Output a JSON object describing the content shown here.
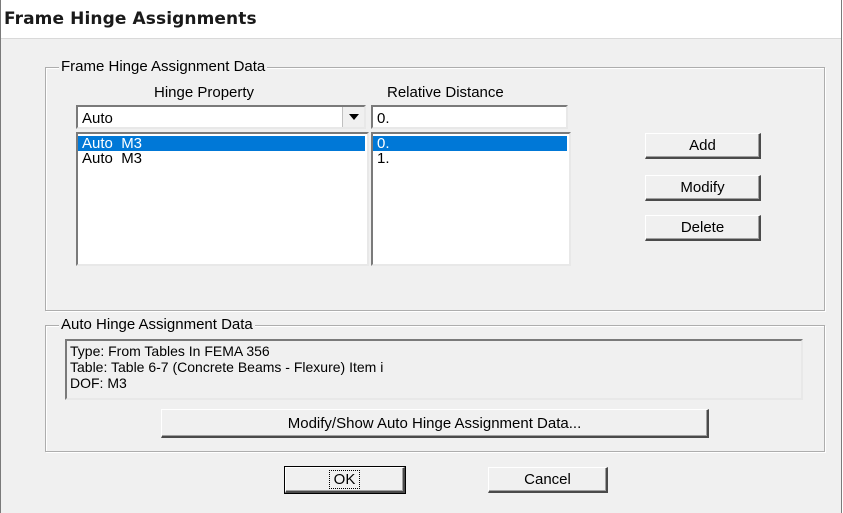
{
  "window": {
    "title": "Frame Hinge Assignments"
  },
  "assignment_group": {
    "legend": "Frame Hinge Assignment Data",
    "hinge_property_header": "Hinge Property",
    "relative_distance_header": "Relative Distance",
    "hinge_property_selected": "Auto",
    "relative_distance_value": "0.",
    "hinge_list": [
      {
        "label": "Auto  M3",
        "selected": true
      },
      {
        "label": "Auto  M3",
        "selected": false
      }
    ],
    "distance_list": [
      {
        "label": "0.",
        "selected": true
      },
      {
        "label": "1.",
        "selected": false
      }
    ],
    "buttons": {
      "add": "Add",
      "modify": "Modify",
      "delete": "Delete"
    }
  },
  "auto_group": {
    "legend": "Auto Hinge Assignment Data",
    "info_lines": [
      "Type:  From Tables In FEMA 356",
      "Table:  Table 6-7 (Concrete Beams - Flexure) Item i",
      "DOF:  M3"
    ],
    "modify_show_button": "Modify/Show Auto Hinge Assignment Data..."
  },
  "footer": {
    "ok": "OK",
    "cancel": "Cancel"
  },
  "colors": {
    "selection": "#0078d7",
    "dialog_bg": "#f0f0f0"
  },
  "icons": {
    "combo_arrow": "chevron-down-icon"
  }
}
